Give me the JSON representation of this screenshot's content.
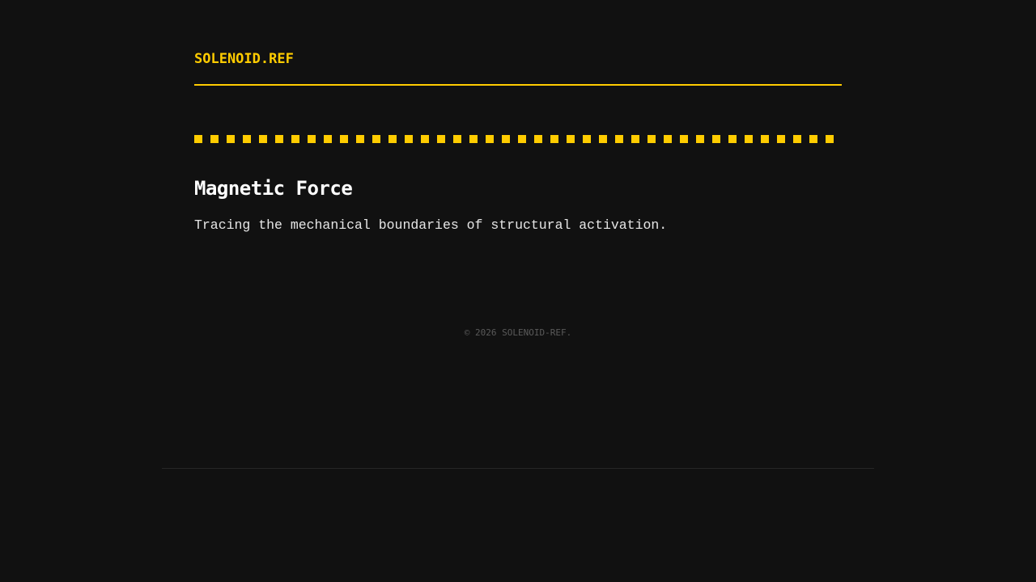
{
  "header": {
    "brand": "SOLENOID.REF"
  },
  "main": {
    "title": "Magnetic Force",
    "subtitle": "Tracing the mechanical boundaries of structural activation."
  },
  "footer": {
    "copyright": "© 2026 SOLENOID-REF."
  },
  "colors": {
    "accent": "#ffcc00",
    "background": "#111111",
    "text": "#ffffff",
    "muted": "#5a5a5a"
  }
}
